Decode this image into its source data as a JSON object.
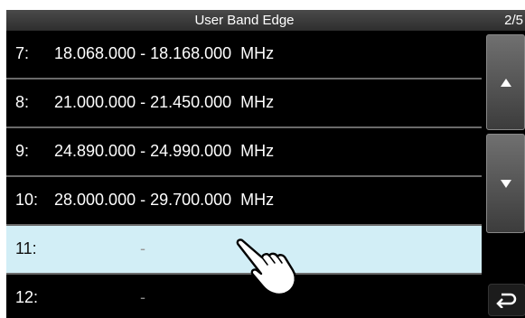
{
  "header": {
    "title": "User Band Edge",
    "page": "2/5"
  },
  "rows": [
    {
      "num": "7:",
      "range": "18.068.000 - 18.168.000  MHz"
    },
    {
      "num": "8:",
      "range": "21.000.000 - 21.450.000  MHz"
    },
    {
      "num": "9:",
      "range": "24.890.000 - 24.990.000  MHz"
    },
    {
      "num": "10:",
      "range": "28.000.000 - 29.700.000  MHz"
    },
    {
      "num": "11:",
      "dash": "-"
    },
    {
      "num": "12:",
      "dash": "-"
    }
  ],
  "icons": {
    "up": "triangle-up-icon",
    "down": "triangle-down-icon",
    "back": "return-arrow-icon",
    "pointer": "pointing-hand-icon"
  },
  "colors": {
    "selected_row": "#d2eef6",
    "background": "#000000",
    "divider": "#6a6a6a"
  }
}
